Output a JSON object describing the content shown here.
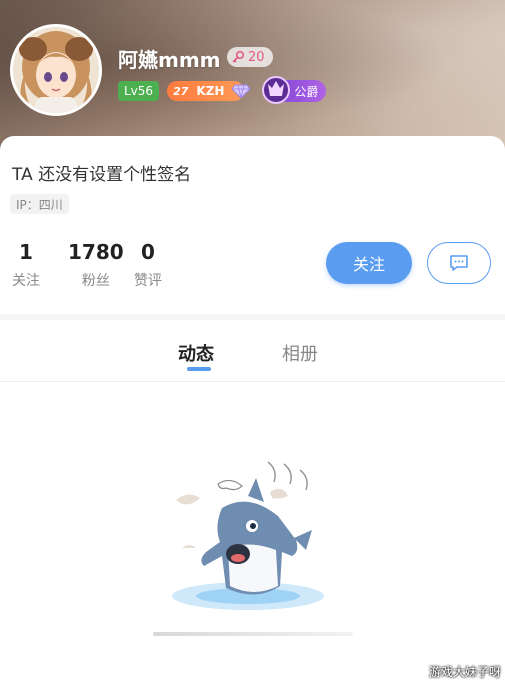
{
  "profile": {
    "nickname": "阿嬿mmm",
    "pink_badge_value": "20",
    "level_label": "Lv56",
    "kzh_number": "27",
    "kzh_label": "KZH",
    "guild_label": "公爵"
  },
  "bio": {
    "signature": "TA 还没有设置个性签名",
    "ip_location": "IP：四川"
  },
  "stats": [
    {
      "value": "1",
      "label": "关注"
    },
    {
      "value": "1780",
      "label": "粉丝"
    },
    {
      "value": "0",
      "label": "赞评"
    }
  ],
  "actions": {
    "follow_label": "关注",
    "message_icon": "chat-bubble-icon"
  },
  "tabs": [
    {
      "label": "动态",
      "active": true
    },
    {
      "label": "相册",
      "active": false
    }
  ],
  "empty_state": {
    "illustration": "shark-mascot-icon"
  },
  "watermark": "游戏大妹子呀",
  "colors": {
    "accent": "#5a9cf0",
    "level_green": "#4caf50",
    "kzh_orange": "#ff7a3d",
    "guild_purple": "#7a3fd1"
  }
}
